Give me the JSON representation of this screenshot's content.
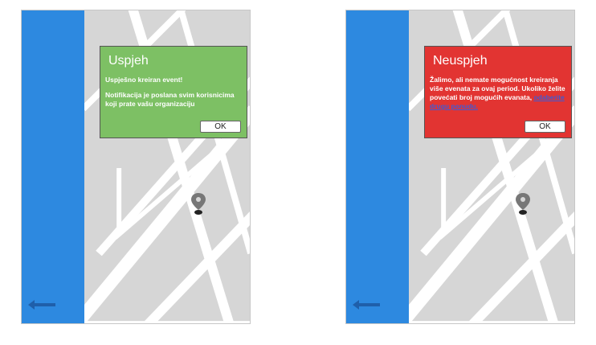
{
  "success_dialog": {
    "title": "Uspjeh",
    "line1": "Uspješno kreiran event!",
    "line2": "Notifikacija je poslana svim korisnicima koji prate vašu organizaciju",
    "ok_label": "OK"
  },
  "error_dialog": {
    "title": "Neuspjeh",
    "message": "Žalimo, ali nemate mogućnost kreiranja više evenata za ovaj period. Ukoliko želite povećati broj mogućih evanata,",
    "link": "odaberite drugu ponudu.",
    "ok_label": "OK"
  },
  "colors": {
    "sidebar": "#2d89e0",
    "success": "#7dc064",
    "error": "#e23432",
    "map": "#d6d6d6"
  },
  "icons": [
    "back-arrow-icon",
    "map-pin-icon"
  ]
}
